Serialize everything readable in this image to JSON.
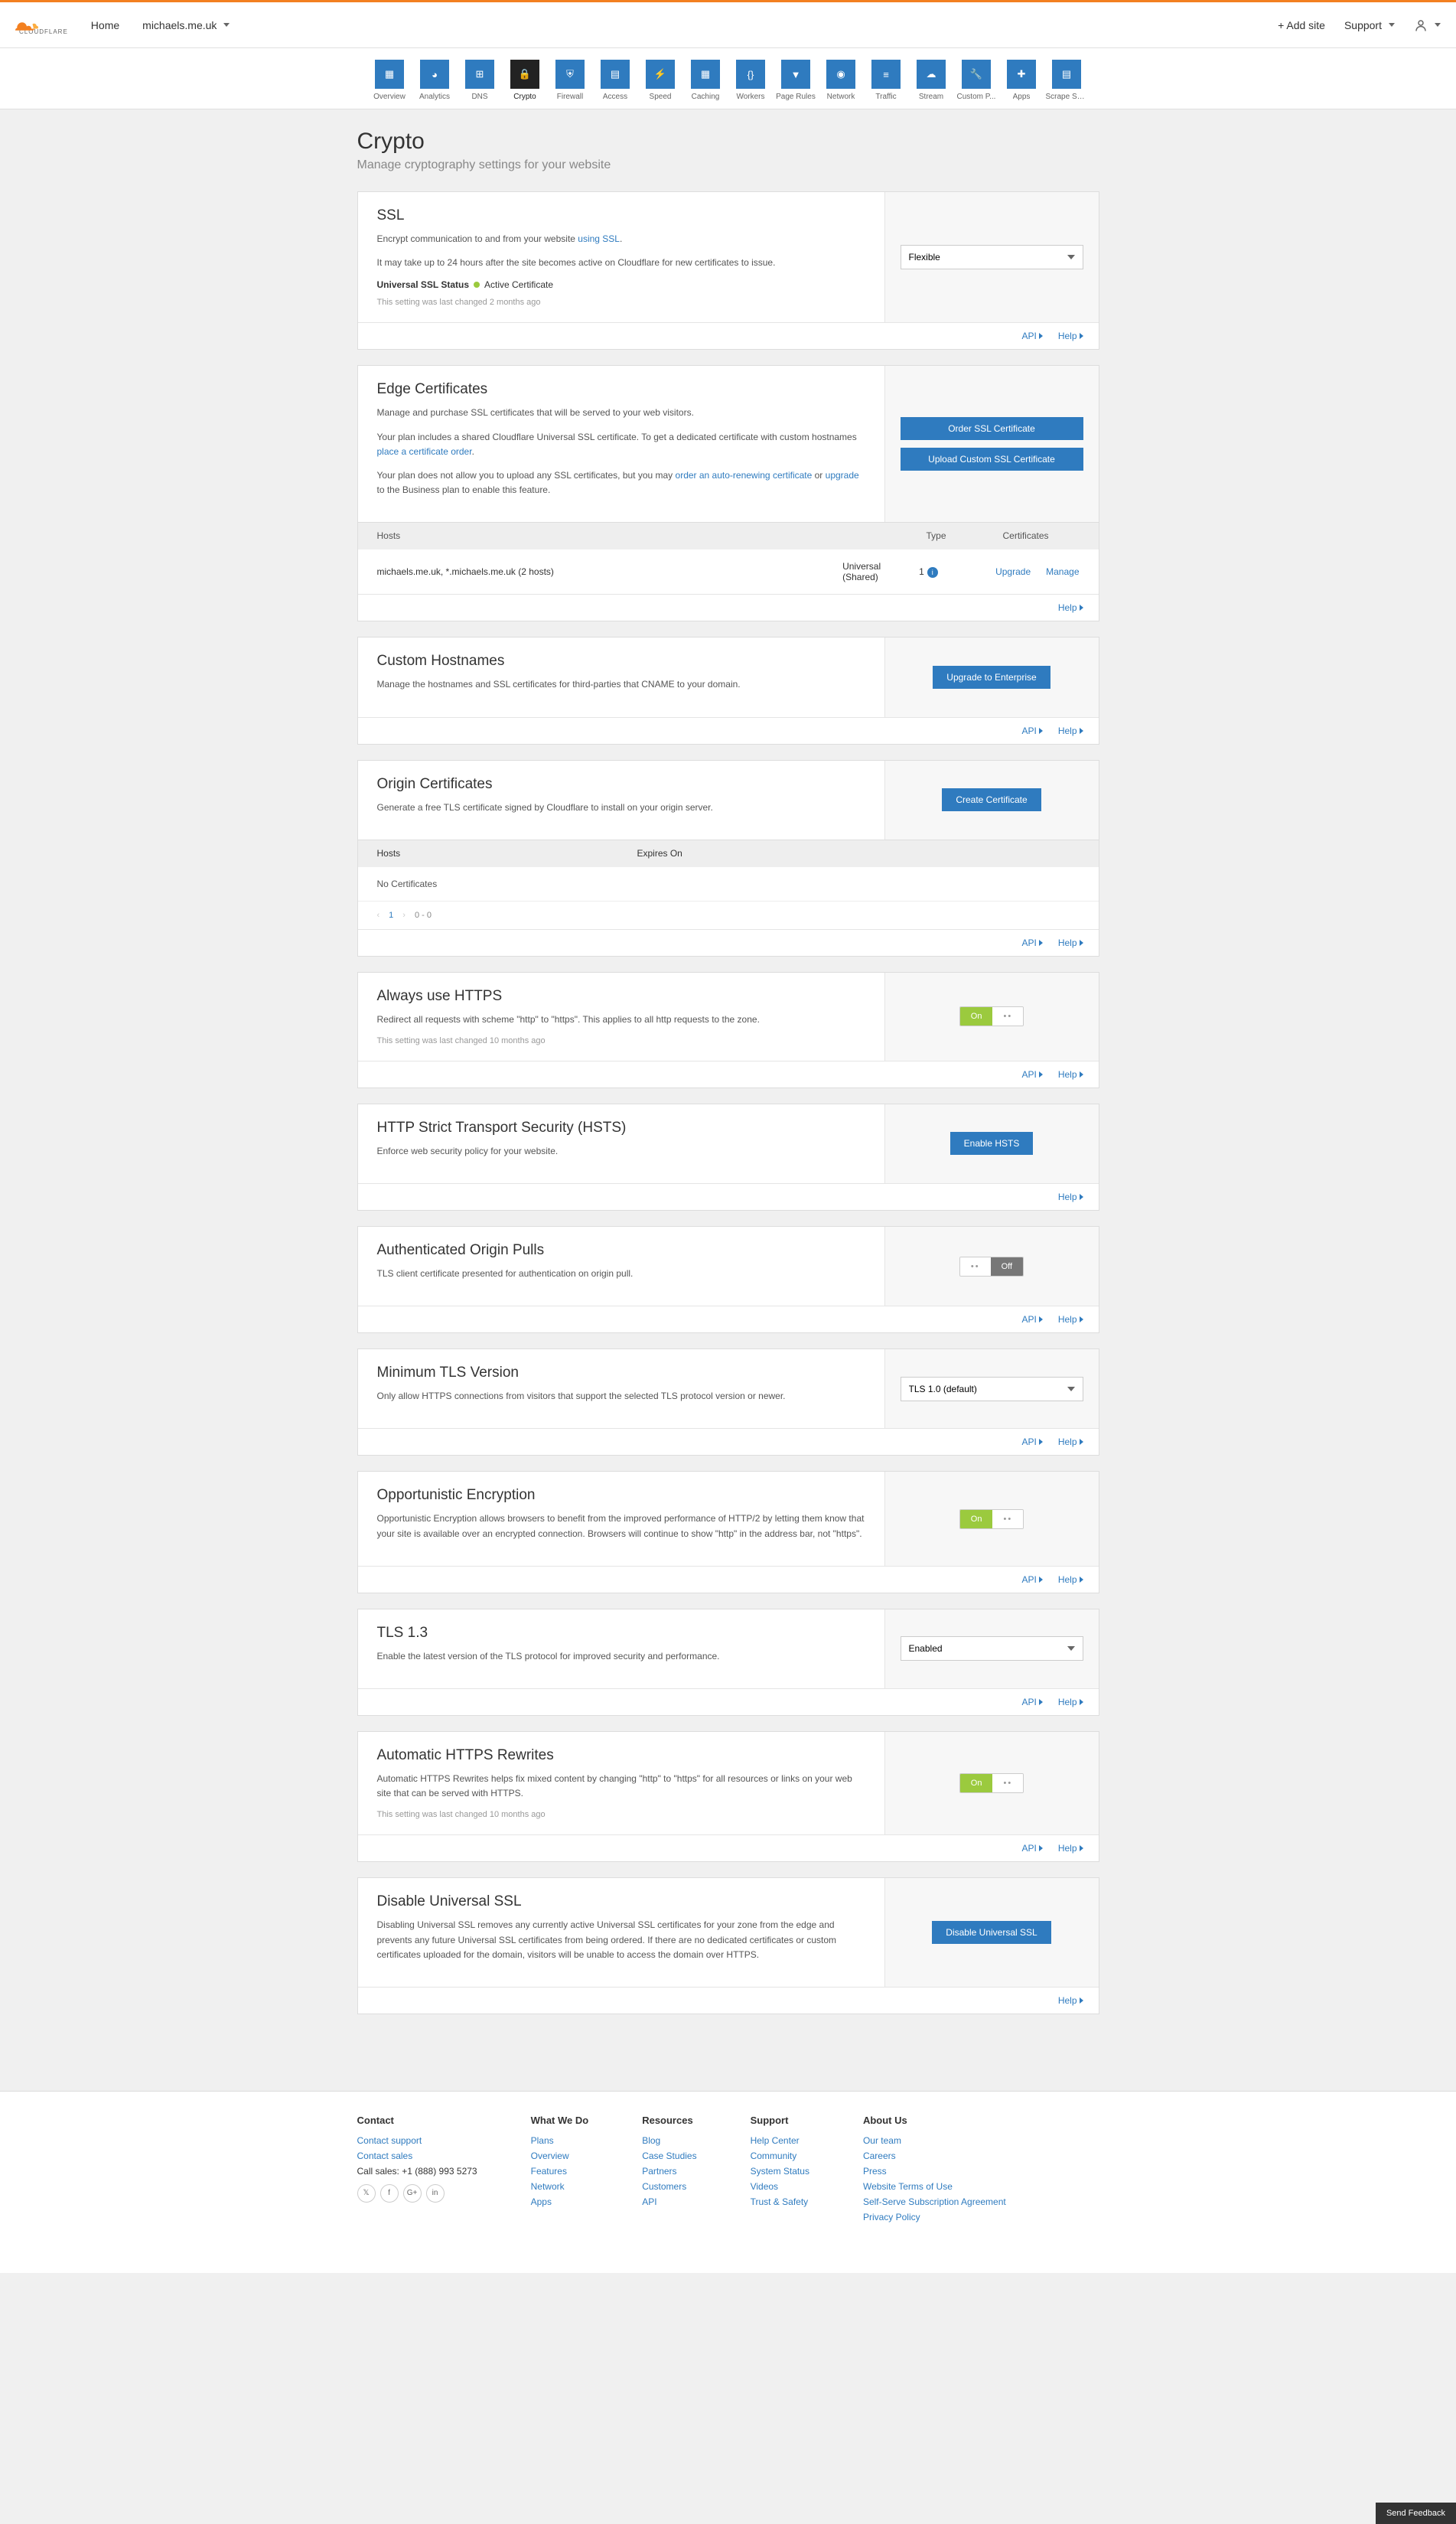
{
  "header": {
    "home": "Home",
    "domain": "michaels.me.uk",
    "add_site": "+ Add site",
    "support": "Support"
  },
  "tabs": [
    {
      "label": "Overview"
    },
    {
      "label": "Analytics"
    },
    {
      "label": "DNS"
    },
    {
      "label": "Crypto"
    },
    {
      "label": "Firewall"
    },
    {
      "label": "Access"
    },
    {
      "label": "Speed"
    },
    {
      "label": "Caching"
    },
    {
      "label": "Workers"
    },
    {
      "label": "Page Rules"
    },
    {
      "label": "Network"
    },
    {
      "label": "Traffic"
    },
    {
      "label": "Stream"
    },
    {
      "label": "Custom P..."
    },
    {
      "label": "Apps"
    },
    {
      "label": "Scrape Sh..."
    }
  ],
  "page": {
    "title": "Crypto",
    "subtitle": "Manage cryptography settings for your website"
  },
  "common": {
    "api": "API",
    "help": "Help"
  },
  "ssl": {
    "title": "SSL",
    "desc1a": "Encrypt communication to and from your website ",
    "desc1_link": "using SSL",
    "desc2": "It may take up to 24 hours after the site becomes active on Cloudflare for new certificates to issue.",
    "status_label": "Universal SSL Status",
    "status_value": "Active Certificate",
    "meta": "This setting was last changed 2 months ago",
    "select": "Flexible"
  },
  "edge": {
    "title": "Edge Certificates",
    "desc1": "Manage and purchase SSL certificates that will be served to your web visitors.",
    "desc2a": "Your plan includes a shared Cloudflare Universal SSL certificate. To get a dedicated certificate with custom hostnames ",
    "desc2_link": "place a certificate order",
    "desc3a": "Your plan does not allow you to upload any SSL certificates, but you may ",
    "desc3_link1": "order an auto-renewing certificate",
    "desc3_or": " or ",
    "desc3_link2": "upgrade",
    "desc3b": " to the Business plan to enable this feature.",
    "btn1": "Order SSL Certificate",
    "btn2": "Upload Custom SSL Certificate",
    "th_hosts": "Hosts",
    "th_type": "Type",
    "th_certs": "Certificates",
    "td_hosts": "michaels.me.uk, *.michaels.me.uk (2 hosts)",
    "td_type": "Universal (Shared)",
    "td_certs": "1",
    "act_upgrade": "Upgrade",
    "act_manage": "Manage"
  },
  "custom_hostnames": {
    "title": "Custom Hostnames",
    "desc": "Manage the hostnames and SSL certificates for third-parties that CNAME to your domain.",
    "btn": "Upgrade to Enterprise"
  },
  "origin": {
    "title": "Origin Certificates",
    "desc": "Generate a free TLS certificate signed by Cloudflare to install on your origin server.",
    "btn": "Create Certificate",
    "th_hosts": "Hosts",
    "th_expires": "Expires On",
    "no_certs": "No Certificates",
    "page_num": "1",
    "page_range": "0 - 0"
  },
  "always_https": {
    "title": "Always use HTTPS",
    "desc": "Redirect all requests with scheme \"http\" to \"https\". This applies to all http requests to the zone.",
    "meta": "This setting was last changed 10 months ago",
    "on": "On"
  },
  "hsts": {
    "title": "HTTP Strict Transport Security (HSTS)",
    "desc": "Enforce web security policy for your website.",
    "btn": "Enable HSTS"
  },
  "auth_origin": {
    "title": "Authenticated Origin Pulls",
    "desc": "TLS client certificate presented for authentication on origin pull.",
    "off": "Off"
  },
  "min_tls": {
    "title": "Minimum TLS Version",
    "desc": "Only allow HTTPS connections from visitors that support the selected TLS protocol version or newer.",
    "select": "TLS 1.0 (default)"
  },
  "opp_enc": {
    "title": "Opportunistic Encryption",
    "desc": "Opportunistic Encryption allows browsers to benefit from the improved performance of HTTP/2 by letting them know that your site is available over an encrypted connection. Browsers will continue to show \"http\" in the address bar, not \"https\".",
    "on": "On"
  },
  "tls13": {
    "title": "TLS 1.3",
    "desc": "Enable the latest version of the TLS protocol for improved security and performance.",
    "select": "Enabled"
  },
  "auto_rewrites": {
    "title": "Automatic HTTPS Rewrites",
    "desc": "Automatic HTTPS Rewrites helps fix mixed content by changing \"http\" to \"https\" for all resources or links on your web site that can be served with HTTPS.",
    "meta": "This setting was last changed 10 months ago",
    "on": "On"
  },
  "disable_ussl": {
    "title": "Disable Universal SSL",
    "desc": "Disabling Universal SSL removes any currently active Universal SSL certificates for your zone from the edge and prevents any future Universal SSL certificates from being ordered. If there are no dedicated certificates or custom certificates uploaded for the domain, visitors will be unable to access the domain over HTTPS.",
    "btn": "Disable Universal SSL"
  },
  "footer": {
    "contact": {
      "title": "Contact",
      "support": "Contact support",
      "sales": "Contact sales",
      "phone": "Call sales: +1 (888) 993 5273"
    },
    "whatwedo": {
      "title": "What We Do",
      "plans": "Plans",
      "overview": "Overview",
      "features": "Features",
      "network": "Network",
      "apps": "Apps"
    },
    "resources": {
      "title": "Resources",
      "blog": "Blog",
      "case": "Case Studies",
      "partners": "Partners",
      "customers": "Customers",
      "api": "API"
    },
    "support": {
      "title": "Support",
      "help": "Help Center",
      "community": "Community",
      "status": "System Status",
      "videos": "Videos",
      "trust": "Trust & Safety"
    },
    "about": {
      "title": "About Us",
      "team": "Our team",
      "careers": "Careers",
      "press": "Press",
      "terms": "Website Terms of Use",
      "subscription": "Self-Serve Subscription Agreement",
      "privacy": "Privacy Policy"
    }
  },
  "feedback": "Send Feedback"
}
